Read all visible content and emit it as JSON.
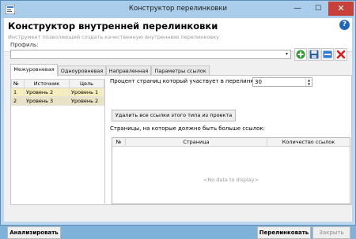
{
  "window": {
    "title": "Конструктор перелинковки",
    "min_glyph": "—",
    "max_glyph": "☐",
    "close_glyph": "✕"
  },
  "header": {
    "title": "Конструктор внутренней перелинковки",
    "subtitle": "Инструмент позволяющий создать качественную внутреннюю перелинковку",
    "help_glyph": "?"
  },
  "profile": {
    "label": "Профиль:",
    "value": "",
    "arrow_glyph": "▾"
  },
  "toolbar": {
    "icons": [
      "add-icon",
      "save-icon",
      "rename-icon",
      "delete-icon"
    ]
  },
  "tabs": [
    {
      "label": "Межуровневая",
      "active": true
    },
    {
      "label": "Одноуровневая",
      "active": false
    },
    {
      "label": "Направленная",
      "active": false
    },
    {
      "label": "Параметры ссылок",
      "active": false
    }
  ],
  "levels_table": {
    "columns": [
      "№",
      "Источник",
      "Цель"
    ],
    "rows": [
      {
        "num": "1",
        "source": "Уровень 2",
        "target": "Уровень 1"
      },
      {
        "num": "2",
        "source": "Уровень 3",
        "target": "Уровень 2"
      }
    ]
  },
  "percent": {
    "label": "Процент страниц который участвует в перелинковке:",
    "value": "30"
  },
  "delete_links_button": "Удалить все ссылки этого типа из проекта",
  "pages": {
    "label": "Страницы, на которые должно быть больше ссылок:",
    "columns": [
      "№",
      "Страница",
      "Количество ссылок"
    ],
    "empty_text": "<No data to display>"
  },
  "footer": {
    "analyze": "Анализировать",
    "relink": "Перелинковать",
    "close": "Закрыть"
  },
  "colors": {
    "accent": "#1f68b8",
    "selected_row": "#f5edbd",
    "add": "#2e9a2e",
    "delete": "#d42020",
    "save": "#2f5d9a"
  }
}
